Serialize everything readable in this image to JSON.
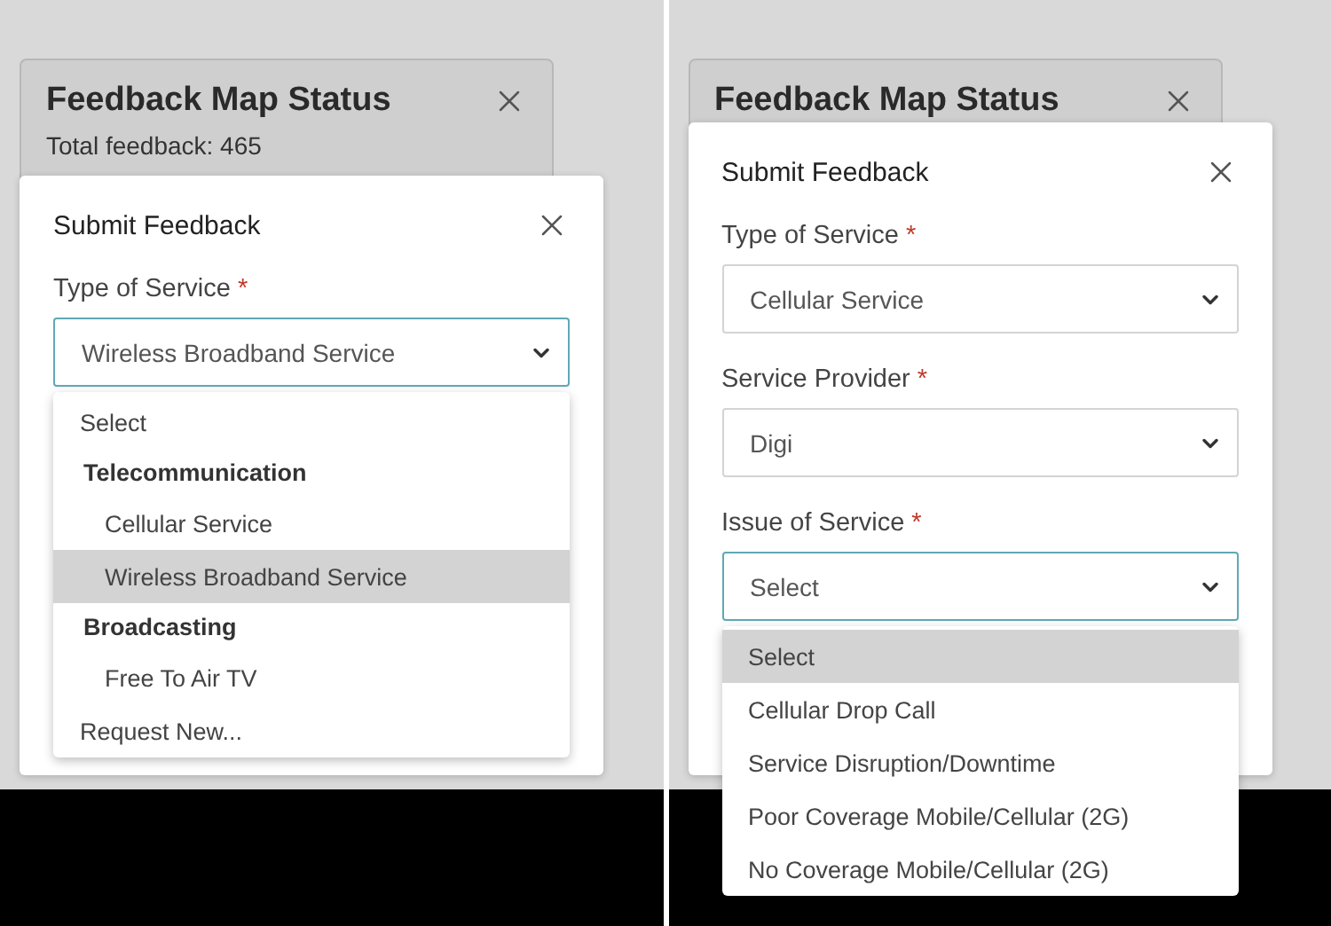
{
  "panes": [
    {
      "status_card": {
        "title": "Feedback Map Status",
        "total": "Total feedback: 465"
      },
      "modal": {
        "title": "Submit Feedback",
        "fields": [
          {
            "label": "Type of Service",
            "required_mark": "*",
            "value": "Wireless Broadband Service",
            "focused": true,
            "dropdown": [
              {
                "kind": "option",
                "label": "Select",
                "selected": false
              },
              {
                "kind": "group",
                "label": "Telecommunication",
                "children": [
                  {
                    "kind": "option",
                    "label": "Cellular Service",
                    "selected": false
                  },
                  {
                    "kind": "option",
                    "label": "Wireless Broadband Service",
                    "selected": true
                  }
                ]
              },
              {
                "kind": "group",
                "label": "Broadcasting",
                "children": [
                  {
                    "kind": "option",
                    "label": "Free To Air TV",
                    "selected": false
                  }
                ]
              },
              {
                "kind": "option",
                "label": "Request New...",
                "selected": false
              }
            ]
          }
        ]
      }
    },
    {
      "status_card": {
        "title": "Feedback Map Status"
      },
      "modal": {
        "title": "Submit Feedback",
        "fields": [
          {
            "label": "Type of Service",
            "required_mark": "*",
            "value": "Cellular Service",
            "focused": false
          },
          {
            "label": "Service Provider",
            "required_mark": "*",
            "value": "Digi",
            "focused": false
          },
          {
            "label": "Issue of Service",
            "required_mark": "*",
            "value": "Select",
            "focused": true,
            "dropdown": [
              {
                "kind": "option",
                "label": "Select",
                "selected": true
              },
              {
                "kind": "option",
                "label": "Cellular Drop Call",
                "selected": false
              },
              {
                "kind": "option",
                "label": "Service Disruption/Downtime",
                "selected": false
              },
              {
                "kind": "option",
                "label": "Poor Coverage Mobile/Cellular (2G)",
                "selected": false
              },
              {
                "kind": "option",
                "label": "No Coverage Mobile/Cellular (2G)",
                "selected": false
              }
            ]
          }
        ]
      }
    }
  ]
}
